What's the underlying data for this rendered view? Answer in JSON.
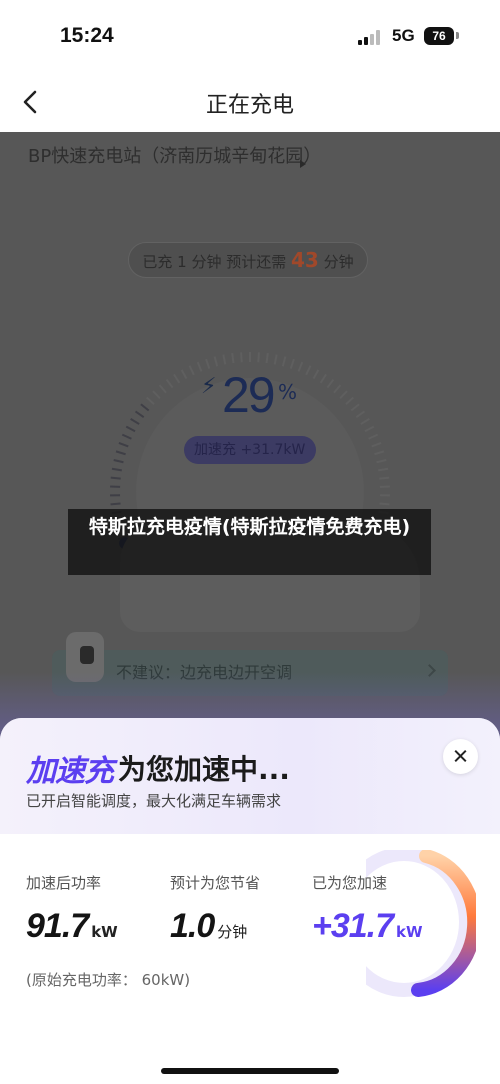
{
  "status_bar": {
    "time": "15:24",
    "network": "5G",
    "battery": "76"
  },
  "nav": {
    "title": "正在充电"
  },
  "station": {
    "name": "BP快速充电站（济南历城辛甸花园）"
  },
  "charging": {
    "time_pill": {
      "prefix": "已充 ",
      "charged_minutes": "1",
      "middle": " 分钟  预计还需 ",
      "remaining_minutes": "43",
      "suffix": " 分钟"
    },
    "percent": "29",
    "percent_sign": "%",
    "battery_level": 0.29,
    "accel_pill": "加速充 +31.7kW",
    "tip": "不建议：边充电边开空调"
  },
  "watermark": {
    "text": "特斯拉充电疫情(特斯拉疫情免费充电)"
  },
  "sheet": {
    "brand": "加速充",
    "title_rest": "为您加速中...",
    "subtitle": "已开启智能调度，最大化满足车辆需求",
    "stats": [
      {
        "label": "加速后功率",
        "value": "91.7",
        "unit": "kW"
      },
      {
        "label": "预计为您节省",
        "value": "1.0",
        "unit": "分钟"
      },
      {
        "label": "已为您加速",
        "value": "+31.7",
        "unit": "kW"
      }
    ],
    "original_power": "(原始充电功率：  60kW)"
  },
  "colors": {
    "accent": "#5b3ff0",
    "orange": "#e0622a",
    "overlay": "#575757"
  },
  "icons": {
    "back": "chevron-left-icon",
    "close": "close-icon",
    "bolt": "lightning-bolt-icon",
    "chevron": "chevron-right-icon"
  }
}
